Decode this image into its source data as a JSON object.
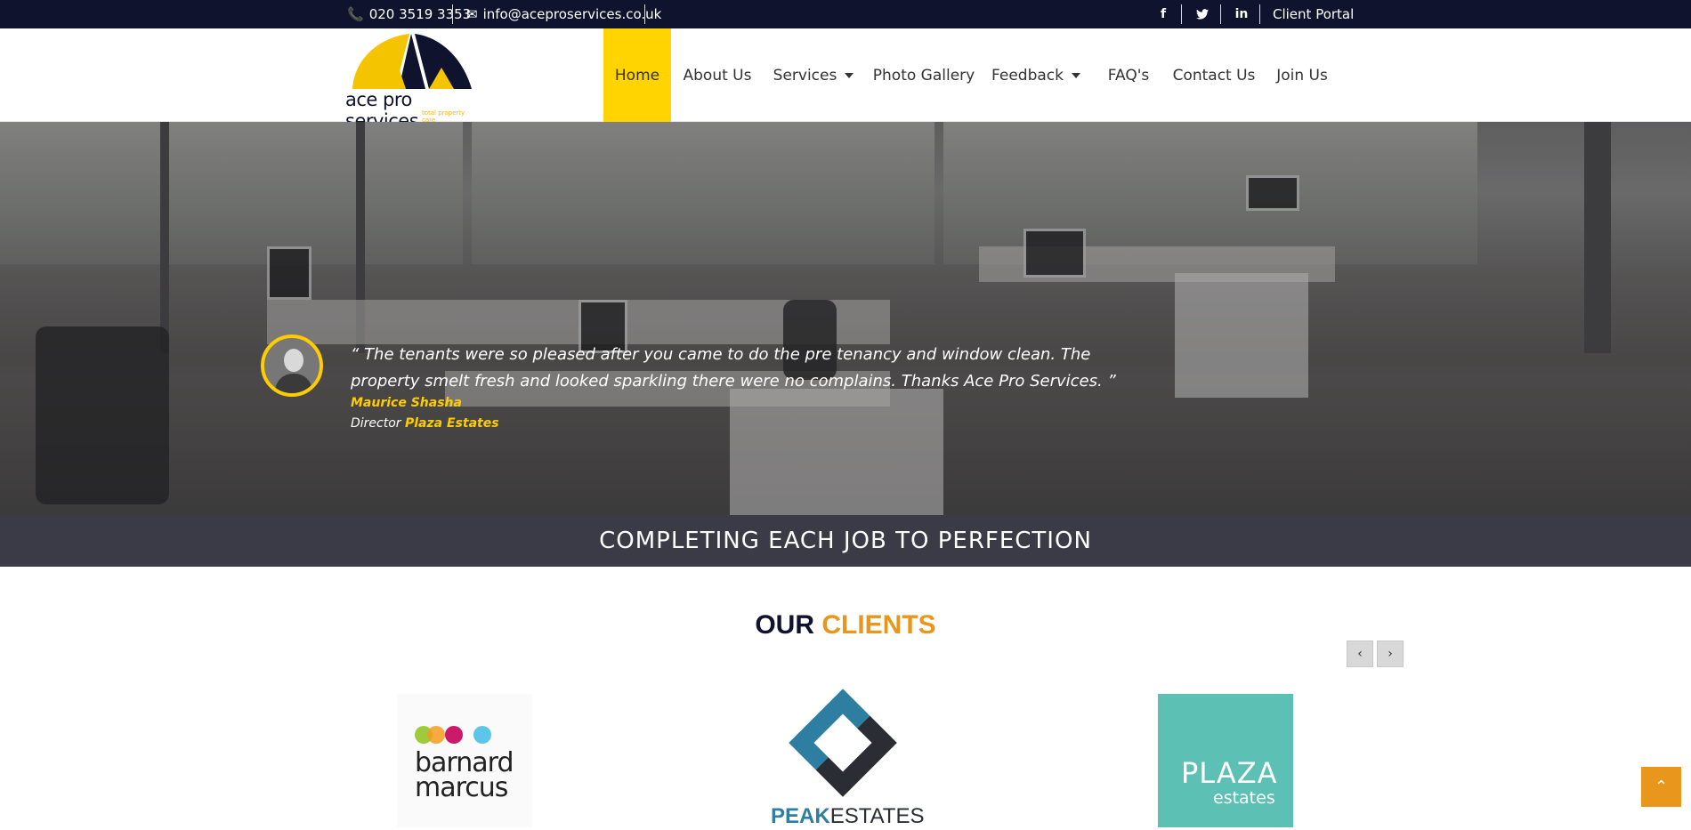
{
  "topbar": {
    "phone": "020 3519 3353",
    "email": "info@aceproservices.co.uk",
    "social": [
      {
        "icon": "facebook-icon",
        "glyph": "f"
      },
      {
        "icon": "twitter-icon",
        "glyph": "🐦"
      },
      {
        "icon": "linkedin-icon",
        "glyph": "in"
      }
    ],
    "client_portal": "Client Portal"
  },
  "logo": {
    "name": "ace pro services",
    "tagline": "total property care",
    "colors": {
      "navy": "#10132e",
      "yellow": "#f5b700"
    }
  },
  "nav": {
    "items": [
      {
        "label": "Home",
        "active": true,
        "dropdown": false
      },
      {
        "label": "About Us",
        "active": false,
        "dropdown": false
      },
      {
        "label": "Services",
        "active": false,
        "dropdown": true
      },
      {
        "label": "Photo Gallery",
        "active": false,
        "dropdown": false
      },
      {
        "label": "Feedback",
        "active": false,
        "dropdown": true
      },
      {
        "label": "FAQ's",
        "active": false,
        "dropdown": false
      },
      {
        "label": "Contact Us",
        "active": false,
        "dropdown": false
      },
      {
        "label": "Join Us",
        "active": false,
        "dropdown": false
      }
    ],
    "active_color": "#ffd400"
  },
  "testimonial": {
    "quote": "“ The tenants were so pleased after you came to do the pre tenancy and window clean. The property smelt fresh and looked sparkling there were no complains. Thanks Ace Pro Services. ”",
    "author": "Maurice Shasha",
    "role": "Director",
    "company": "Plaza Estates"
  },
  "tagline": "COMPLETING EACH JOB TO PERFECTION",
  "clients": {
    "title_part1": "OUR",
    "title_part2": "CLIENTS",
    "prev_icon": "chevron-left-icon",
    "next_icon": "chevron-right-icon",
    "logos": [
      {
        "name": "barnard marcus",
        "line1": "barnard",
        "line2": "marcus"
      },
      {
        "name": "PEAKESTATES",
        "part1": "PEAK",
        "part2": "ESTATES"
      },
      {
        "name": "PLAZA estates",
        "part1": "PLAZA",
        "part2": "estates",
        "bg_color": "#5cc0b5"
      }
    ]
  },
  "scroll_top_icon": "chevron-up-icon",
  "colors": {
    "accent_orange": "#e8971c",
    "topbar_bg": "#10132e",
    "band_bg": "#3a3b47"
  }
}
